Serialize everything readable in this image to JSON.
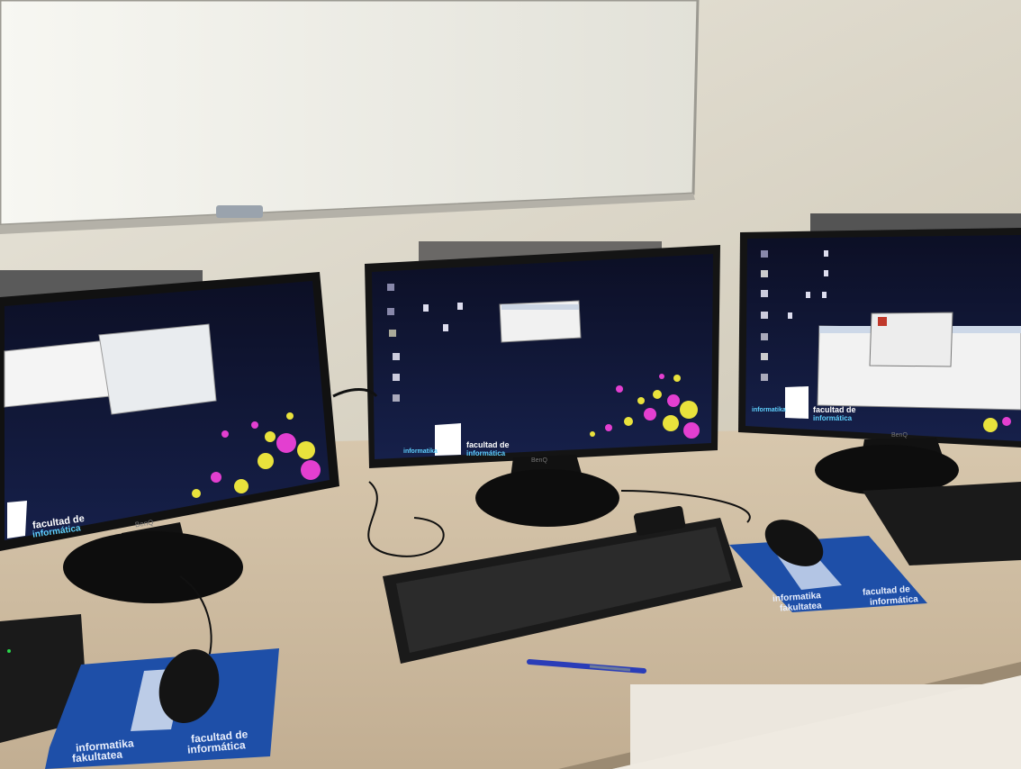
{
  "scene": {
    "description_colors": {
      "wall": "#d9d3c2",
      "whiteboard": "#ecebe3",
      "desk": "#c8b79f",
      "screen": "#0f1330",
      "dot_pink": "#e33fd0",
      "dot_yellow": "#e9e23c",
      "mousepad_blue": "#1e4fa8"
    }
  },
  "monitors": {
    "left": {
      "brand_label": "BenQ",
      "logo_line1": "facultad de",
      "logo_line2": "informática",
      "windows": [
        "dialog",
        "calendar"
      ]
    },
    "center": {
      "brand_label": "BenQ",
      "logo_line1": "facultad de",
      "logo_line2": "informática",
      "logo_prefix": "informatika",
      "windows": [
        "small-dialog"
      ]
    },
    "right": {
      "brand_label": "BenQ",
      "logo_line1": "facultad de",
      "logo_line2": "informática",
      "logo_prefix": "informatika",
      "windows": [
        "file-explorer",
        "about-dialog"
      ]
    }
  },
  "mousepads": {
    "left": {
      "line1_left": "informatika",
      "line2_left": "fakultatea",
      "line1_right": "facultad de",
      "line2_right": "informática"
    },
    "right": {
      "line1_left": "informatika",
      "line2_left": "fakultatea",
      "line1_right": "facultad de",
      "line2_right": "informática"
    }
  }
}
